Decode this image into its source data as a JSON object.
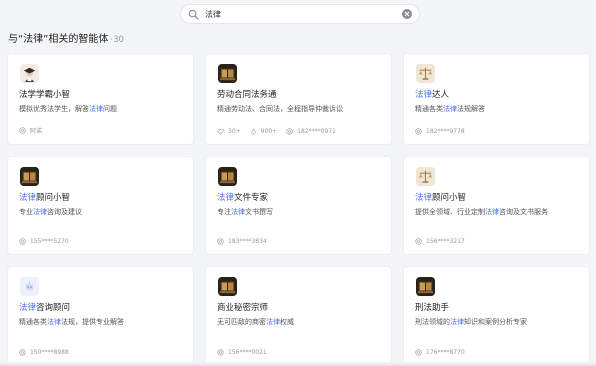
{
  "search": {
    "value": "法律",
    "placeholder": ""
  },
  "results": {
    "title": "与“法律”相关的智能体",
    "count": "·30"
  },
  "colors": {
    "highlight": "#4f6ef2",
    "background": "#f4f5f7"
  },
  "cards": [
    {
      "icon": "scholar-avatar-icon",
      "name": [
        "法学学霸小智"
      ],
      "desc": [
        "模拟优秀法学生，解答",
        {
          "hl": "法律"
        },
        "问题"
      ],
      "meta": {
        "author": "阿诺",
        "likes": "",
        "uses": ""
      }
    },
    {
      "icon": "book-avatar-icon",
      "name": [
        "劳动合同法务通"
      ],
      "desc": [
        "精通劳动法、合同法，全程指导仲裁诉讼"
      ],
      "meta": {
        "author": "182****0971",
        "likes": "30+",
        "uses": "900+"
      }
    },
    {
      "icon": "scales-avatar-icon",
      "name": [
        {
          "hl": "法律"
        },
        "达人"
      ],
      "desc": [
        "精通各类",
        {
          "hl": "法律"
        },
        "法规解答"
      ],
      "meta": {
        "author": "182****9778",
        "likes": "",
        "uses": ""
      }
    },
    {
      "icon": "book-avatar-icon",
      "name": [
        {
          "hl": "法律"
        },
        "顾问小智"
      ],
      "desc": [
        "专业",
        {
          "hl": "法律"
        },
        "咨询及建议"
      ],
      "meta": {
        "author": "155****5270",
        "likes": "",
        "uses": ""
      }
    },
    {
      "icon": "book-avatar-icon",
      "name": [
        {
          "hl": "法律"
        },
        "文件专家"
      ],
      "desc": [
        "专注",
        {
          "hl": "法律"
        },
        "文书撰写"
      ],
      "meta": {
        "author": "183****3834",
        "likes": "",
        "uses": ""
      }
    },
    {
      "icon": "scales-avatar-icon",
      "name": [
        {
          "hl": "法律"
        },
        "顾问小智"
      ],
      "desc": [
        "提供全领域、行业定制",
        {
          "hl": "法律"
        },
        "咨询及文书服务"
      ],
      "meta": {
        "author": "156****3217",
        "likes": "",
        "uses": ""
      }
    },
    {
      "icon": "robot-avatar-icon",
      "name": [
        {
          "hl": "法律"
        },
        "咨询顾问"
      ],
      "desc": [
        "精通各类",
        {
          "hl": "法律"
        },
        "法规，提供专业解答"
      ],
      "meta": {
        "author": "150****8988",
        "likes": "",
        "uses": ""
      }
    },
    {
      "icon": "book-avatar-icon",
      "name": [
        "商业秘密宗师"
      ],
      "desc": [
        "无可匹敌的商密",
        {
          "hl": "法律"
        },
        "权威"
      ],
      "meta": {
        "author": "156****0021",
        "likes": "",
        "uses": ""
      }
    },
    {
      "icon": "book-avatar-icon",
      "name": [
        "刑法助手"
      ],
      "desc": [
        "刑法领域的",
        {
          "hl": "法律"
        },
        "知识和案例分析专家"
      ],
      "meta": {
        "author": "176****8770",
        "likes": "",
        "uses": ""
      }
    }
  ]
}
